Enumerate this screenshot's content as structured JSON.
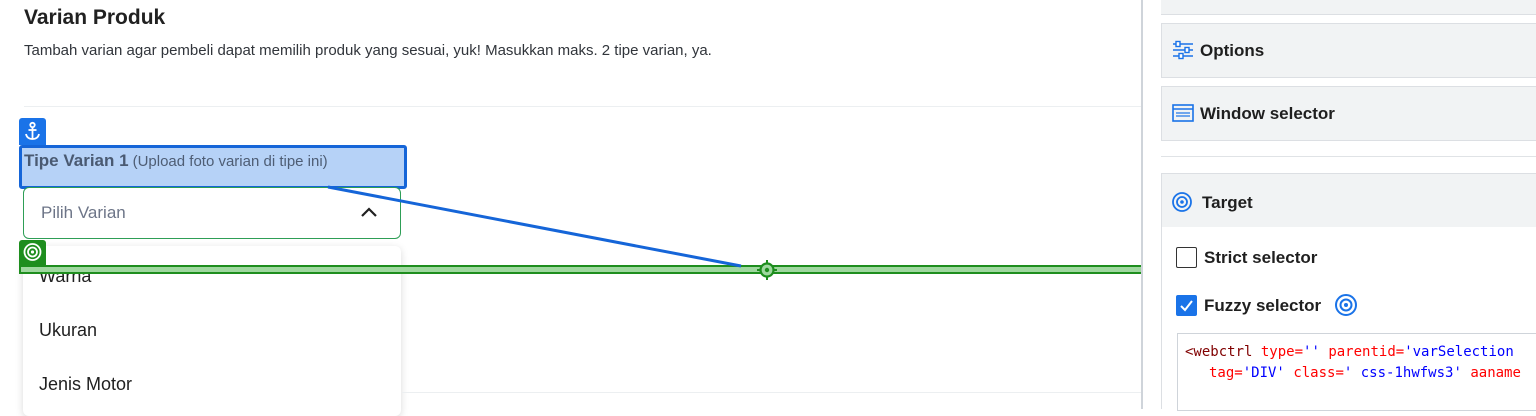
{
  "page": {
    "title": "Varian Produk",
    "subtitle": "Tambah varian agar pembeli dapat memilih produk yang sesuai, yuk! Masukkan maks. 2 tipe varian, ya."
  },
  "variant_type": {
    "label": "Tipe Varian 1",
    "hint": "(Upload foto varian di tipe ini)",
    "select_placeholder": "Pilih Varian",
    "options": [
      "Warna",
      "Ukuran",
      "Jenis Motor"
    ]
  },
  "panel": {
    "options_label": "Options",
    "window_selector_label": "Window selector",
    "target_label": "Target",
    "strict_selector_label": "Strict selector",
    "strict_selector_checked": false,
    "fuzzy_selector_label": "Fuzzy selector",
    "fuzzy_selector_checked": true,
    "selector_code": {
      "line1": {
        "tag_open": "<webctrl",
        "a1": "type=",
        "v1": "''",
        "a2": "parentid=",
        "v2": "'varSelection"
      },
      "line2": {
        "a1": "tag=",
        "v1": "'DIV'",
        "a2": "class=",
        "v2": "' css-1hwfws3'",
        "a3": "aaname"
      }
    }
  },
  "colors": {
    "anchor": "#1565d8",
    "target": "#1e8e1e",
    "select_border": "#2e9e56",
    "checkbox": "#1a73e8"
  },
  "icons": {
    "anchor": "anchor-icon",
    "target": "target-icon",
    "options": "sliders-icon",
    "window": "window-icon",
    "chevron": "chevron-up-icon"
  }
}
